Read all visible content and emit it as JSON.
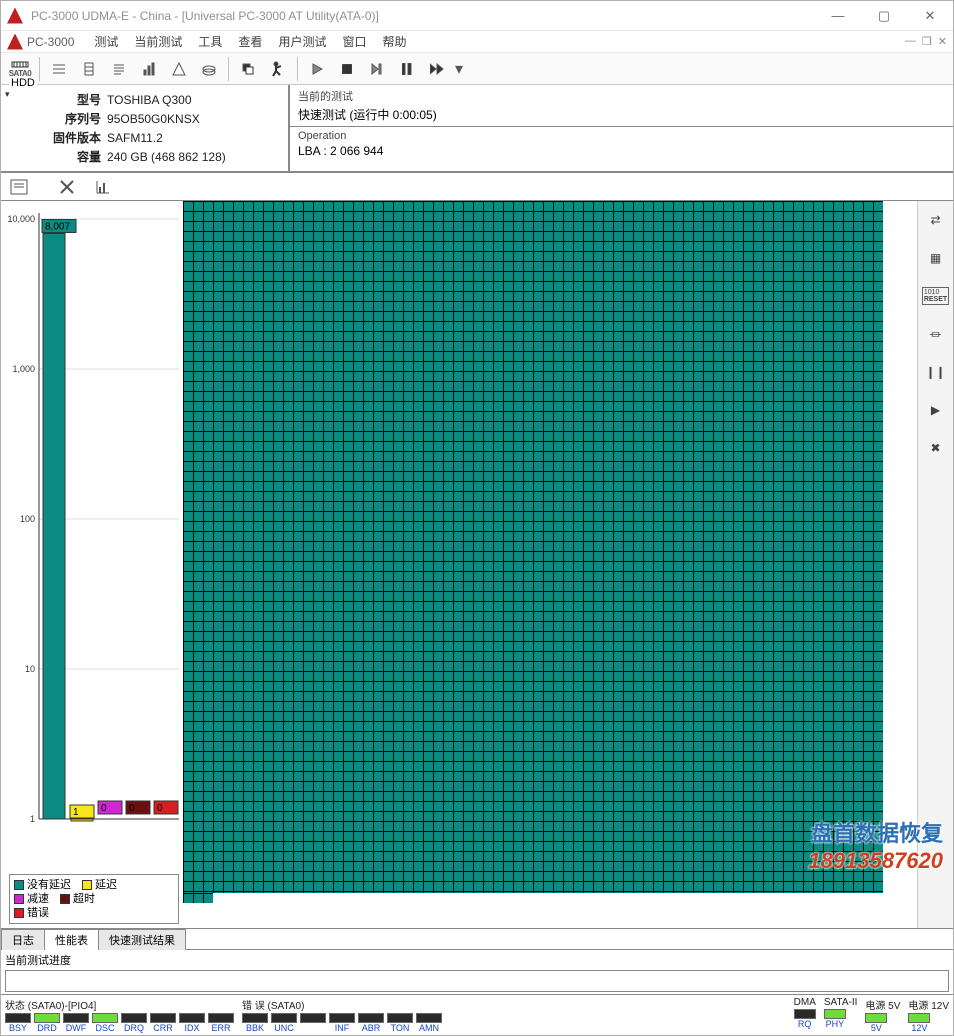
{
  "window": {
    "title": "PC-3000 UDMA-E - China - [Universal PC-3000 AT Utility(ATA-0)]",
    "app_name": "PC-3000"
  },
  "menu": [
    "测试",
    "当前测试",
    "工具",
    "查看",
    "用户测试",
    "窗口",
    "帮助"
  ],
  "hdd": {
    "legend": "HDD",
    "rows": [
      {
        "label": "型号",
        "value": "TOSHIBA Q300"
      },
      {
        "label": "序列号",
        "value": "95OB50G0KNSX"
      },
      {
        "label": "固件版本",
        "value": "SAFM11.2"
      },
      {
        "label": "容量",
        "value": "240 GB (468 862 128)"
      }
    ]
  },
  "current_test": {
    "title": "当前的测试",
    "line": "快速测试 (运行中 0:00:05)"
  },
  "operation": {
    "title": "Operation",
    "line": "LBA : 2 066 944"
  },
  "chart_data": {
    "type": "bar",
    "yscale": "log",
    "yticks": [
      1,
      10,
      100,
      1000,
      10000
    ],
    "categories": [
      "没有延迟",
      "延迟",
      "减速",
      "超时",
      "错误"
    ],
    "colors": [
      "#0b8b82",
      "#f8e61c",
      "#d028d0",
      "#6a1010",
      "#d42020"
    ],
    "values": [
      8007,
      1,
      0,
      0,
      0
    ],
    "labels": [
      "8,007",
      "1",
      "0",
      "0",
      "0"
    ]
  },
  "legend": [
    [
      {
        "c": "#0b8b82",
        "t": "没有延迟"
      },
      {
        "c": "#f8e61c",
        "t": "延迟"
      }
    ],
    [
      {
        "c": "#d028d0",
        "t": "减速"
      },
      {
        "c": "#6a1010",
        "t": "超时"
      }
    ],
    [
      {
        "c": "#d42020",
        "t": "错误"
      }
    ]
  ],
  "tabs": {
    "items": [
      "日志",
      "性能表",
      "快速测试结果"
    ],
    "active": 1
  },
  "progress": {
    "label": "当前测试进度"
  },
  "status": {
    "sata": {
      "title": "状态 (SATA0)-[PIO4]",
      "labels": [
        "BSY",
        "DRD",
        "DWF",
        "DSC",
        "DRQ",
        "CRR",
        "IDX",
        "ERR"
      ],
      "on": [
        false,
        true,
        false,
        true,
        false,
        false,
        false,
        false
      ]
    },
    "err": {
      "title": "错 误 (SATA0)",
      "labels": [
        "BBK",
        "UNC",
        "",
        "INF",
        "ABR",
        "TON",
        "AMN"
      ],
      "on": [
        false,
        false,
        false,
        false,
        false,
        false,
        false
      ]
    },
    "dma": {
      "title": "DMA",
      "labels": [
        "RQ"
      ],
      "on": [
        false
      ]
    },
    "sata2": {
      "title": "SATA-II",
      "labels": [
        "PHY"
      ],
      "on": [
        true
      ]
    },
    "p5": {
      "title": "电源 5V",
      "labels": [
        "5V"
      ],
      "on": [
        true
      ]
    },
    "p12": {
      "title": "电源 12V",
      "labels": [
        "12V"
      ],
      "on": [
        true
      ]
    }
  },
  "right_tools": [
    "⇄",
    "▦",
    "RESET",
    "⏛",
    "❙❙",
    "▶",
    "✖"
  ],
  "watermark": {
    "l1": "盘首数据恢复",
    "l2": "18913587620"
  }
}
